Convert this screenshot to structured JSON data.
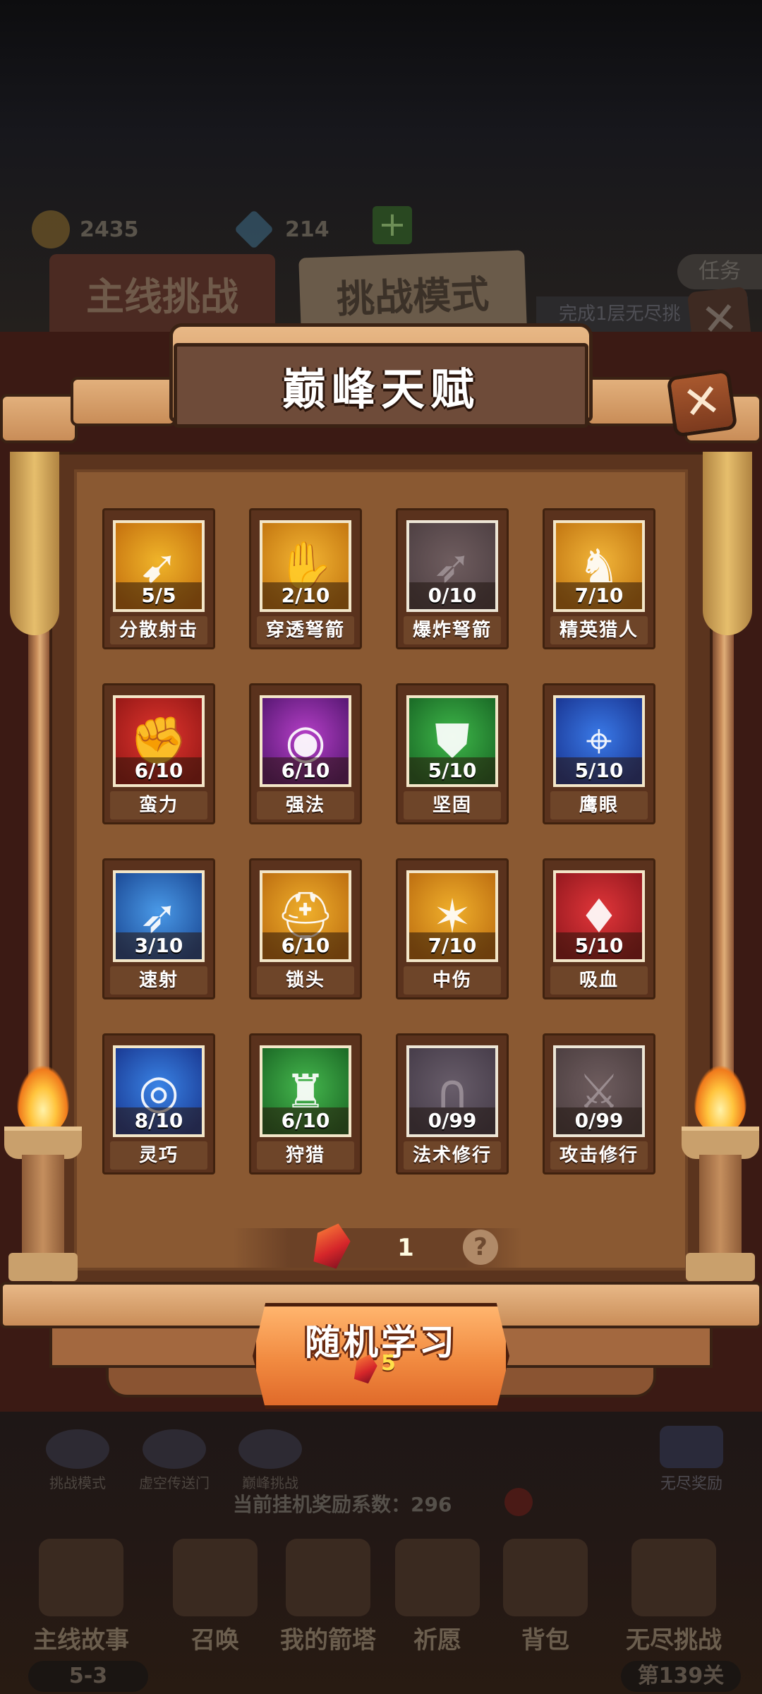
{
  "background": {
    "coins": "2435",
    "gems": "214",
    "tab_main": "主线挑战",
    "tab_challenge": "挑战模式",
    "quest_label": "任务",
    "quest_text": "完成1层无尽挑",
    "shortcuts": [
      "挑战模式",
      "虚空传送门",
      "巅峰挑战"
    ],
    "endless_reward": "无尽奖励",
    "idle_status": "当前挂机奖励系数：296",
    "nav": [
      {
        "label": "主线故事",
        "sub": "5-3"
      },
      {
        "label": "召唤",
        "sub": ""
      },
      {
        "label": "我的箭塔",
        "sub": ""
      },
      {
        "label": "祈愿",
        "sub": ""
      },
      {
        "label": "背包",
        "sub": ""
      },
      {
        "label": "无尽挑战",
        "sub": "第139关"
      }
    ]
  },
  "modal": {
    "title": "巅峰天赋",
    "close_symbol": "✕",
    "talents": [
      {
        "name": "分散射击",
        "level": "5/5",
        "color_a": "#f0b52a",
        "color_b": "#c77410",
        "glyph": "➹",
        "dim": false
      },
      {
        "name": "穿透弩箭",
        "level": "2/10",
        "color_a": "#f4b634",
        "color_b": "#c67a12",
        "glyph": "✋",
        "dim": false
      },
      {
        "name": "爆炸弩箭",
        "level": "0/10",
        "color_a": "#7a5a5e",
        "color_b": "#5a3f44",
        "glyph": "➶",
        "dim": true
      },
      {
        "name": "精英猎人",
        "level": "7/10",
        "color_a": "#f2b63a",
        "color_b": "#c57a14",
        "glyph": "♞",
        "dim": false
      },
      {
        "name": "蛮力",
        "level": "6/10",
        "color_a": "#e2362e",
        "color_b": "#9a1a18",
        "glyph": "✊",
        "dim": false
      },
      {
        "name": "强法",
        "level": "6/10",
        "color_a": "#b640c8",
        "color_b": "#5d1a78",
        "glyph": "◉",
        "dim": false
      },
      {
        "name": "坚固",
        "level": "5/10",
        "color_a": "#3fb84a",
        "color_b": "#1c6e28",
        "glyph": "⛊",
        "dim": false
      },
      {
        "name": "鹰眼",
        "level": "5/10",
        "color_a": "#3a7ae8",
        "color_b": "#1c3a98",
        "glyph": "⌖",
        "dim": false
      },
      {
        "name": "速射",
        "level": "3/10",
        "color_a": "#4a9ae8",
        "color_b": "#1e4e9a",
        "glyph": "➶",
        "dim": false
      },
      {
        "name": "锁头",
        "level": "6/10",
        "color_a": "#f0b02c",
        "color_b": "#c07212",
        "glyph": "⛑",
        "dim": false
      },
      {
        "name": "中伤",
        "level": "7/10",
        "color_a": "#f0b02c",
        "color_b": "#c07212",
        "glyph": "✶",
        "dim": false
      },
      {
        "name": "吸血",
        "level": "5/10",
        "color_a": "#e2363a",
        "color_b": "#981a20",
        "glyph": "♦",
        "dim": false
      },
      {
        "name": "灵巧",
        "level": "8/10",
        "color_a": "#3a84e6",
        "color_b": "#1c3e98",
        "glyph": "◎",
        "dim": false
      },
      {
        "name": "狩猎",
        "level": "6/10",
        "color_a": "#46b84e",
        "color_b": "#1e6e28",
        "glyph": "♜",
        "dim": false
      },
      {
        "name": "法术修行",
        "level": "0/99",
        "color_a": "#6e5a72",
        "color_b": "#4f3c55",
        "glyph": "∩",
        "dim": true
      },
      {
        "name": "攻击修行",
        "level": "0/99",
        "color_a": "#7a5a5c",
        "color_b": "#583e42",
        "glyph": "⚔",
        "dim": true
      }
    ],
    "crystal_count": "1",
    "help_symbol": "?",
    "learn_button": "随机学习",
    "learn_cost": "5"
  }
}
